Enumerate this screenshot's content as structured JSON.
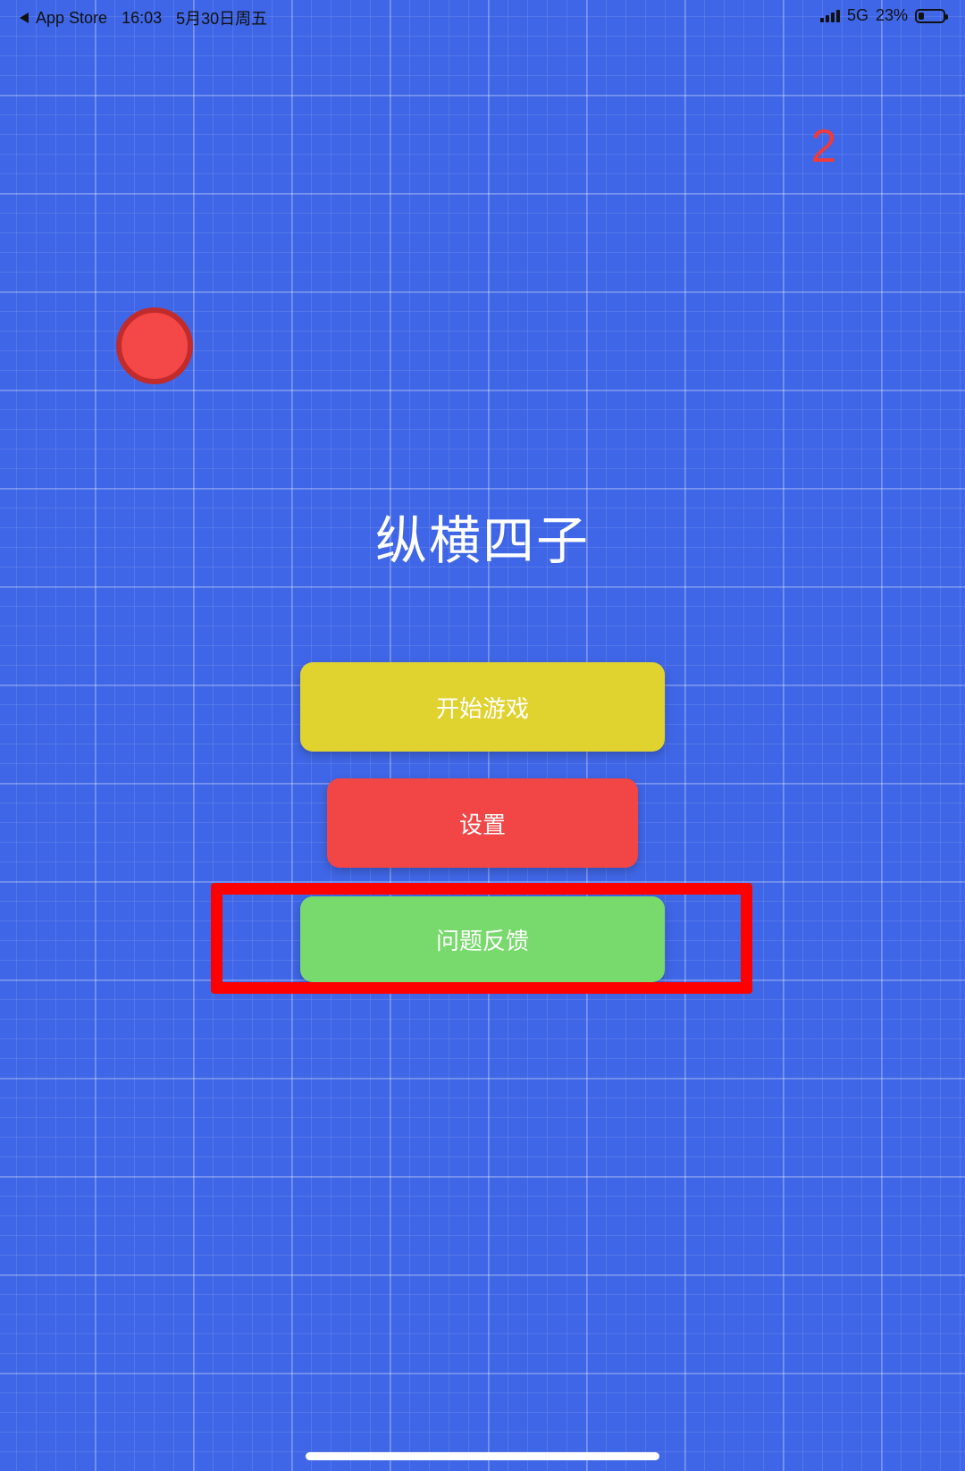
{
  "status_bar": {
    "back_app": "App Store",
    "time": "16:03",
    "date": "5月30日周五",
    "network": "5G",
    "battery": "23%",
    "battery_level": 0.23
  },
  "game": {
    "score": "2",
    "title": "纵横四子",
    "chip_color": "#f44747"
  },
  "menu": {
    "start_label": "开始游戏",
    "settings_label": "设置",
    "feedback_label": "问题反馈"
  },
  "colors": {
    "background": "#3f66e6",
    "start": "#e0d22f",
    "settings": "#f24545",
    "feedback": "#78d96d",
    "highlight": "#ff0000"
  },
  "icons": [
    "back-arrow-icon",
    "signal-icon",
    "battery-icon"
  ]
}
